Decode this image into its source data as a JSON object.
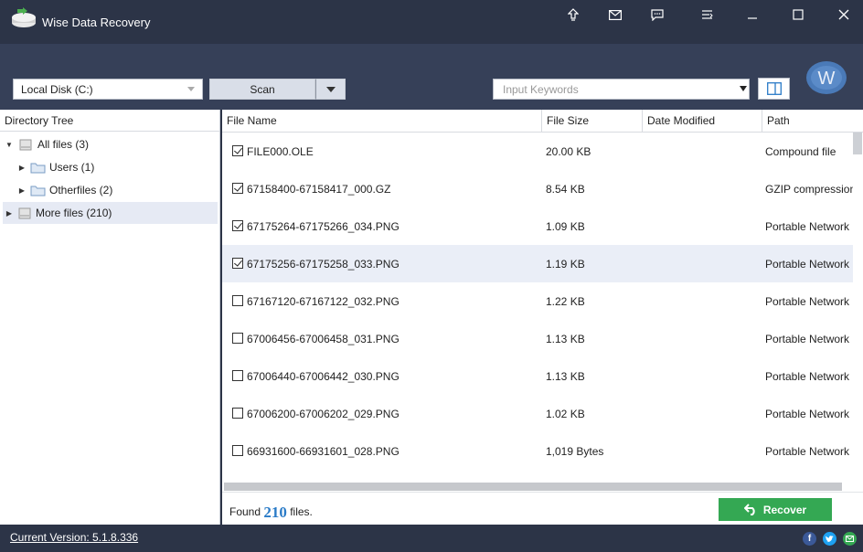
{
  "app": {
    "title": "Wise Data Recovery"
  },
  "toolbar": {
    "drive": "Local Disk (C:)",
    "scan_label": "Scan",
    "keywords_placeholder": "Input Keywords",
    "logo_letter": "W"
  },
  "tree": {
    "header": "Directory Tree",
    "items": [
      {
        "label": "All files (3)"
      },
      {
        "label": "Users (1)"
      },
      {
        "label": "Otherfiles (2)"
      },
      {
        "label": "More files (210)"
      }
    ]
  },
  "table": {
    "columns": [
      "File Name",
      "File Size",
      "Date Modified",
      "Path"
    ],
    "rows": [
      {
        "name": "FILE000.OLE",
        "size": "20.00 KB",
        "modified": "",
        "path": "Compound file",
        "checked": true
      },
      {
        "name": "67158400-67158417_000.GZ",
        "size": "8.54 KB",
        "modified": "",
        "path": "GZIP compression fi",
        "checked": true
      },
      {
        "name": "67175264-67175266_034.PNG",
        "size": "1.09 KB",
        "modified": "",
        "path": "Portable Network ...",
        "checked": true
      },
      {
        "name": "67175256-67175258_033.PNG",
        "size": "1.19 KB",
        "modified": "",
        "path": "Portable Network ...",
        "checked": true
      },
      {
        "name": "67167120-67167122_032.PNG",
        "size": "1.22 KB",
        "modified": "",
        "path": "Portable Network ...",
        "checked": false
      },
      {
        "name": "67006456-67006458_031.PNG",
        "size": "1.13 KB",
        "modified": "",
        "path": "Portable Network ...",
        "checked": false
      },
      {
        "name": "67006440-67006442_030.PNG",
        "size": "1.13 KB",
        "modified": "",
        "path": "Portable Network ...",
        "checked": false
      },
      {
        "name": "67006200-67006202_029.PNG",
        "size": "1.02 KB",
        "modified": "",
        "path": "Portable Network ...",
        "checked": false
      },
      {
        "name": "66931600-66931601_028.PNG",
        "size": "1,019 Bytes",
        "modified": "",
        "path": "Portable Network ...",
        "checked": false
      }
    ]
  },
  "footer": {
    "found_prefix": "Found",
    "found_count": "210",
    "found_suffix": "files.",
    "recover_label": "Recover"
  },
  "status": {
    "version": "Current Version: 5.1.8.336",
    "social": {
      "facebook": "f"
    }
  },
  "colors": {
    "accent": "#2a7bc7",
    "recover": "#34a853",
    "chrome": "#2c3447"
  }
}
